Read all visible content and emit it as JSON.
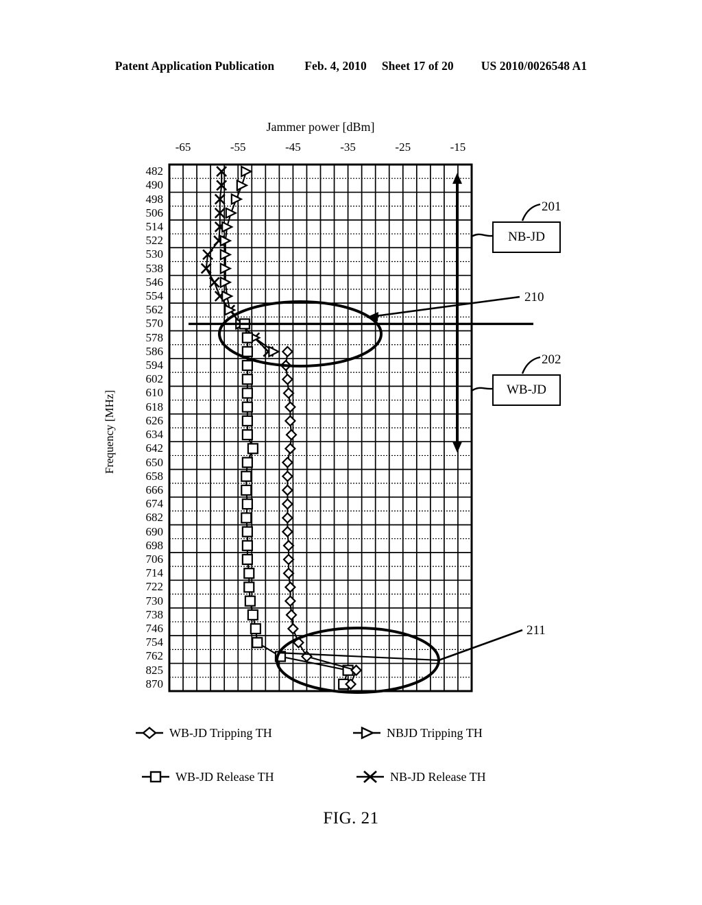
{
  "header": {
    "publication": "Patent Application Publication",
    "date": "Feb. 4, 2010",
    "sheet": "Sheet 17 of 20",
    "patent_number": "US 2010/0026548 A1"
  },
  "figure": {
    "caption": "FIG. 21"
  },
  "annotations": {
    "box_201_label": "NB-JD",
    "box_201_ref": "201",
    "box_202_label": "WB-JD",
    "box_202_ref": "202",
    "ref_210": "210",
    "ref_211": "211"
  },
  "legend": [
    {
      "label": "WB-JD Tripping TH",
      "marker": "diamond-marker"
    },
    {
      "label": "NBJD Tripping TH",
      "marker": "right-triangle-marker"
    },
    {
      "label": "WB-JD Release TH",
      "marker": "square-marker"
    },
    {
      "label": "NB-JD Release TH",
      "marker": "cross-marker"
    }
  ],
  "chart_data": {
    "type": "scatter",
    "title": "",
    "xlabel": "Jammer power [dBm]",
    "ylabel": "Frequency [MHz]",
    "xlim": [
      -67.5,
      -12.5
    ],
    "xticks": [
      -65,
      -55,
      -45,
      -35,
      -25,
      -15
    ],
    "grid": true,
    "legend_position": "bottom",
    "categories": [
      482,
      490,
      498,
      506,
      514,
      522,
      530,
      538,
      546,
      554,
      562,
      570,
      578,
      586,
      594,
      602,
      610,
      618,
      626,
      634,
      642,
      650,
      658,
      666,
      674,
      682,
      690,
      698,
      706,
      714,
      722,
      730,
      738,
      746,
      754,
      762,
      825,
      870
    ],
    "series": [
      {
        "name": "NB-JD Release TH",
        "marker": "cross-marker",
        "values": [
          -58.0,
          -58.0,
          -58.3,
          -58.3,
          -58.3,
          -58.5,
          -60.5,
          -60.8,
          -59.3,
          -58.3,
          -56.5,
          -54.5,
          -52.0,
          -49.5,
          null,
          null,
          null,
          null,
          null,
          null,
          null,
          null,
          null,
          null,
          null,
          null,
          null,
          null,
          null,
          null,
          null,
          null,
          null,
          null,
          null,
          null,
          null,
          null
        ]
      },
      {
        "name": "NBJD Tripping TH",
        "marker": "right-triangle-marker",
        "values": [
          -53.5,
          -54.3,
          -55.3,
          -56.3,
          -57.0,
          -57.3,
          -57.3,
          -57.3,
          -57.3,
          -57.0,
          -56.5,
          -54.5,
          -52.0,
          -48.5,
          null,
          null,
          null,
          null,
          null,
          null,
          null,
          null,
          null,
          null,
          null,
          null,
          null,
          null,
          null,
          null,
          null,
          null,
          null,
          null,
          null,
          null,
          null,
          null
        ]
      },
      {
        "name": "WB-JD Release TH",
        "marker": "square-marker",
        "values": [
          null,
          null,
          null,
          null,
          null,
          null,
          null,
          null,
          null,
          null,
          null,
          -53.8,
          -53.3,
          -53.3,
          -53.3,
          -53.3,
          -53.3,
          -53.3,
          -53.3,
          -53.3,
          -52.3,
          -53.3,
          -53.5,
          -53.5,
          -53.3,
          -53.5,
          -53.3,
          -53.3,
          -53.3,
          -53.0,
          -53.0,
          -52.8,
          -52.3,
          -51.8,
          -51.5,
          -47.3,
          -35.0,
          -35.8
        ]
      },
      {
        "name": "WB-JD Tripping TH",
        "marker": "diamond-marker",
        "values": [
          null,
          null,
          null,
          null,
          null,
          null,
          null,
          null,
          null,
          null,
          null,
          null,
          null,
          -46.0,
          -46.3,
          -46.0,
          -45.8,
          -45.5,
          -45.5,
          -45.3,
          -45.5,
          -46.0,
          -46.0,
          -46.0,
          -46.0,
          -46.0,
          -46.0,
          -45.8,
          -45.8,
          -45.8,
          -45.5,
          -45.5,
          -45.3,
          -45.0,
          -44.0,
          -42.5,
          -33.5,
          -34.5
        ]
      }
    ],
    "markup": {
      "ellipse_upper_ref": "210",
      "ellipse_lower_ref": "211",
      "horizontal_line_frequency": 570,
      "vertical_arrow_from": 482,
      "vertical_arrow_to": 642
    }
  }
}
